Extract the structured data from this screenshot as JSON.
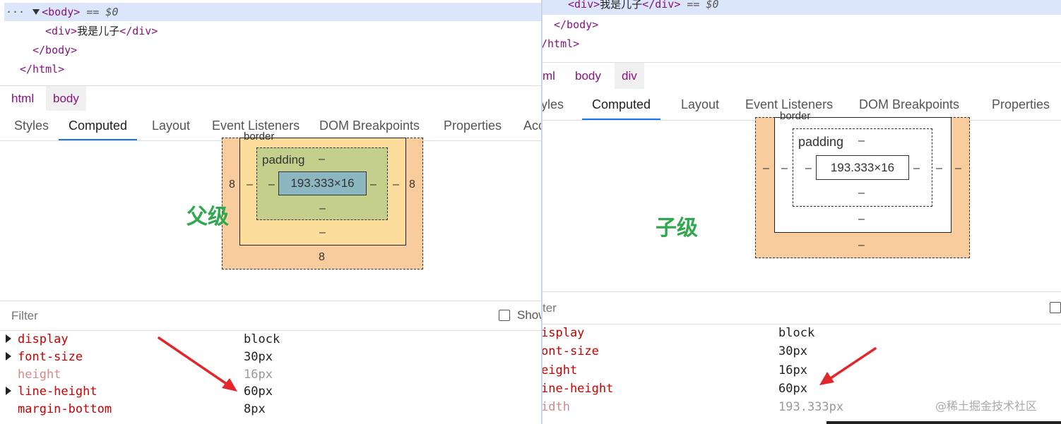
{
  "left": {
    "dom": {
      "body_open": "<body>",
      "eq": "== $0",
      "div_open": "<div>",
      "div_text": "我是儿子",
      "div_close": "</div>",
      "body_close": "</body>",
      "html_close": "</html>",
      "ellipsis": "···"
    },
    "breadcrumbs": [
      "html",
      "body"
    ],
    "tabs": [
      "Styles",
      "Computed",
      "Layout",
      "Event Listeners",
      "DOM Breakpoints",
      "Properties",
      "Acc"
    ],
    "box_model": {
      "border_label": "border",
      "padding_label": "padding",
      "padding_top": "–",
      "content": "193.333×16",
      "margin_left": "8",
      "margin_right": "8",
      "margin_bottom": "8",
      "border_left": "–",
      "border_right": "–",
      "border_bottom": "–",
      "padding_left": "–",
      "padding_right": "–",
      "padding_bottom": "–"
    },
    "annotation": "父级",
    "filter_placeholder": "Filter",
    "show_label": "Show",
    "properties": [
      {
        "name": "display",
        "value": "block"
      },
      {
        "name": "font-size",
        "value": "30px"
      },
      {
        "name": "height",
        "value": "16px"
      },
      {
        "name": "line-height",
        "value": "60px"
      },
      {
        "name": "margin-bottom",
        "value": "8px"
      }
    ]
  },
  "right": {
    "dom": {
      "div_open": "<div>",
      "div_text": "我是儿子",
      "div_close": "</div>",
      "eq": "== $0",
      "body_close": "</body>",
      "html_close": "/html>"
    },
    "breadcrumbs": [
      "ml",
      "body",
      "div"
    ],
    "tabs": [
      "yles",
      "Computed",
      "Layout",
      "Event Listeners",
      "DOM Breakpoints",
      "Properties"
    ],
    "box_model": {
      "border_label": "border",
      "padding_label": "padding",
      "padding_top": "–",
      "content": "193.333×16",
      "margin_left": "–",
      "margin_right": "–",
      "margin_bottom": "–",
      "border_left": "–",
      "border_right": "–",
      "border_bottom": "–",
      "padding_left": "–",
      "padding_right": "–",
      "padding_bottom": "–"
    },
    "annotation": "子级",
    "filter_placeholder": "ter",
    "properties": [
      {
        "name": "isplay",
        "value": "block"
      },
      {
        "name": "ont-size",
        "value": "30px"
      },
      {
        "name": "eight",
        "value": "16px"
      },
      {
        "name": "ine-height",
        "value": "60px"
      },
      {
        "name": "idth",
        "value": "193.333px"
      }
    ],
    "watermark": "@稀土掘金技术社区"
  },
  "colors": {
    "tag": "#881280",
    "prop_name": "#c80000",
    "annotation": "#2fa84f",
    "arrow": "#e3262a",
    "margin": "#f9cc9d",
    "border": "#fddd9b",
    "padding": "#c3cf8a",
    "content": "#8cb6c0",
    "active_tab": "#1a73e8"
  }
}
